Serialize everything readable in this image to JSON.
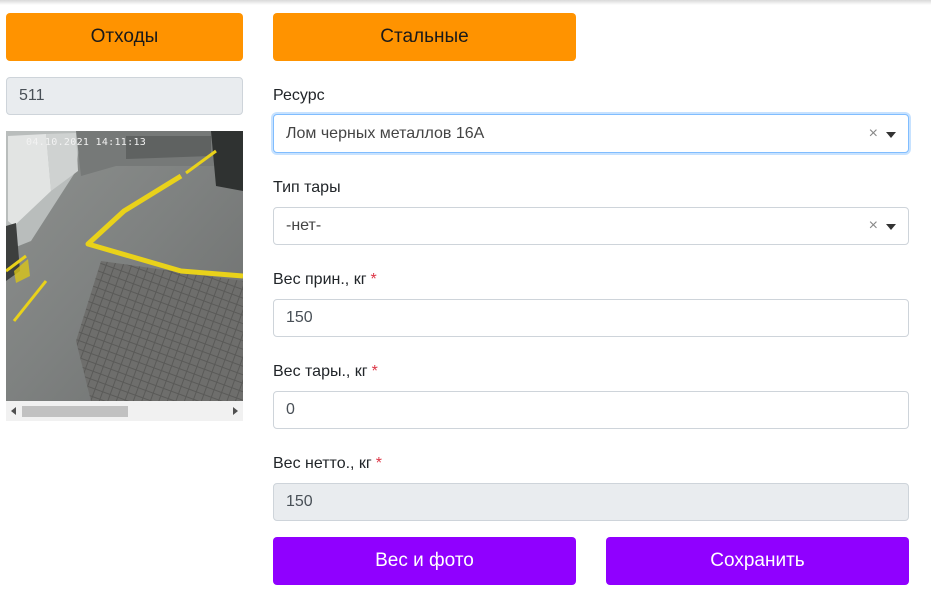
{
  "left": {
    "category_button": "Отходы",
    "id_value": "511",
    "camera_timestamp": "04.10.2021 14:11:13"
  },
  "form": {
    "material_button": "Стальные",
    "resource": {
      "label": "Ресурс",
      "value": "Лом черных металлов 16А"
    },
    "container_type": {
      "label": "Тип тары",
      "value": "-нет-"
    },
    "gross_weight": {
      "label": "Вес прин., кг",
      "value": "150"
    },
    "tare_weight": {
      "label": "Вес тары., кг",
      "value": "0"
    },
    "net_weight": {
      "label": "Вес нетто., кг",
      "value": "150"
    },
    "required_mark": "*",
    "clear_glyph": "×",
    "weigh_photo_button": "Вес и фото",
    "save_button": "Сохранить"
  },
  "colors": {
    "orange_button": "#ff9300",
    "purple_button": "#9000ff",
    "required": "#dc3545"
  }
}
